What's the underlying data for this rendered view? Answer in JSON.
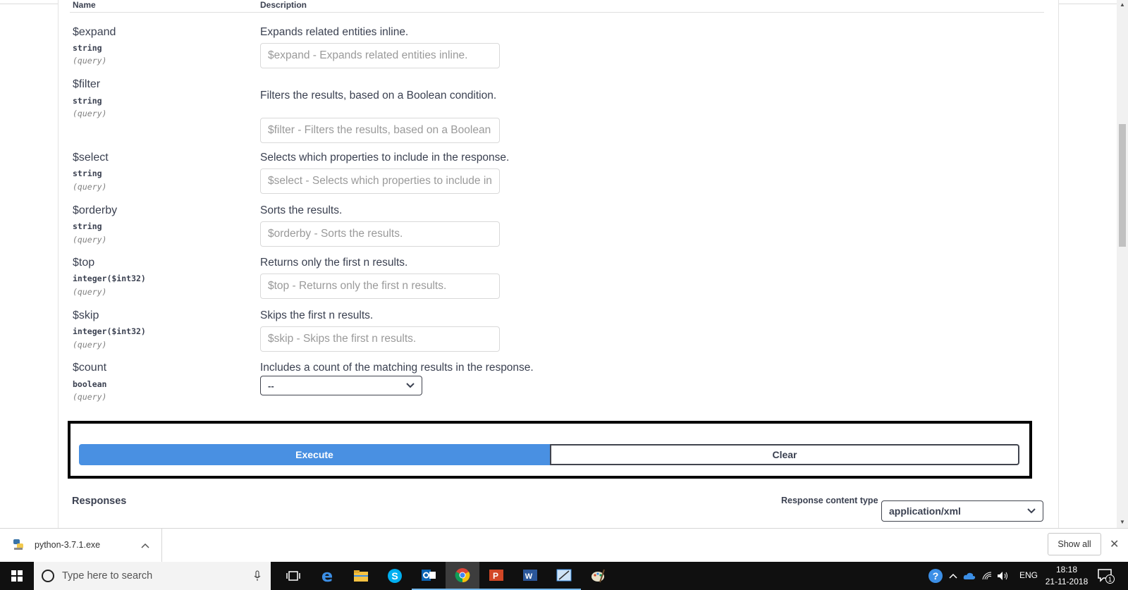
{
  "table": {
    "header_name": "Name",
    "header_description": "Description"
  },
  "params": [
    {
      "name": "$expand",
      "type": "string",
      "in": "(query)",
      "description": "Expands related entities inline.",
      "placeholder": "$expand - Expands related entities inline."
    },
    {
      "name": "$filter",
      "type": "string",
      "in": "(query)",
      "description": "Filters the results, based on a Boolean condition.",
      "placeholder": "$filter - Filters the results, based on a Boolean condition."
    },
    {
      "name": "$select",
      "type": "string",
      "in": "(query)",
      "description": "Selects which properties to include in the response.",
      "placeholder": "$select - Selects which properties to include in the response."
    },
    {
      "name": "$orderby",
      "type": "string",
      "in": "(query)",
      "description": "Sorts the results.",
      "placeholder": "$orderby - Sorts the results."
    },
    {
      "name": "$top",
      "type": "integer($int32)",
      "in": "(query)",
      "description": "Returns only the first n results.",
      "placeholder": "$top - Returns only the first n results."
    },
    {
      "name": "$skip",
      "type": "integer($int32)",
      "in": "(query)",
      "description": "Skips the first n results.",
      "placeholder": "$skip - Skips the first n results."
    },
    {
      "name": "$count",
      "type": "boolean",
      "in": "(query)",
      "description": "Includes a count of the matching results in the response.",
      "selected": "--"
    }
  ],
  "actions": {
    "execute_label": "Execute",
    "clear_label": "Clear"
  },
  "responses": {
    "title": "Responses",
    "content_type_label": "Response content type",
    "content_type_value": "application/xml"
  },
  "download_bar": {
    "file_name": "python-3.7.1.exe",
    "show_all_label": "Show all"
  },
  "taskbar": {
    "search_placeholder": "Type here to search",
    "language": "ENG",
    "time": "18:18",
    "date": "21-11-2018",
    "notification_count": "1"
  },
  "colors": {
    "execute_blue": "#4990e2",
    "text": "#3b4151",
    "taskbar": "#101010"
  }
}
